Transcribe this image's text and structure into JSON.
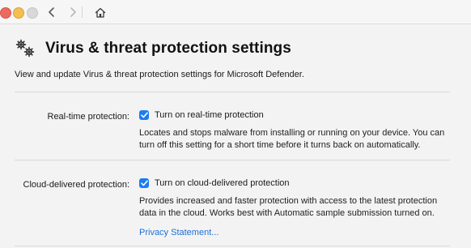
{
  "window": {
    "icons": {
      "back": "chevron-left-icon",
      "forward": "chevron-right-icon",
      "home": "home-icon"
    }
  },
  "header": {
    "icon": "gears-icon",
    "title": "Virus & threat protection settings",
    "subtitle": "View and update Virus & threat protection settings for Microsoft Defender."
  },
  "settings": [
    {
      "label": "Real-time protection:",
      "toggle_label": "Turn on real-time protection",
      "checked": true,
      "description": "Locates and stops malware from installing or running on your device. You can turn off this setting for a short time before it turns back on automatically."
    },
    {
      "label": "Cloud-delivered protection:",
      "toggle_label": "Turn on cloud-delivered protection",
      "checked": true,
      "description": "Provides increased and faster protection with access to the latest protection data in the cloud. Works best with Automatic sample submission turned on.",
      "link": "Privacy Statement..."
    }
  ],
  "colors": {
    "accent": "#1c7cf2",
    "link": "#1f6fd6",
    "background": "#f3f3f3"
  }
}
